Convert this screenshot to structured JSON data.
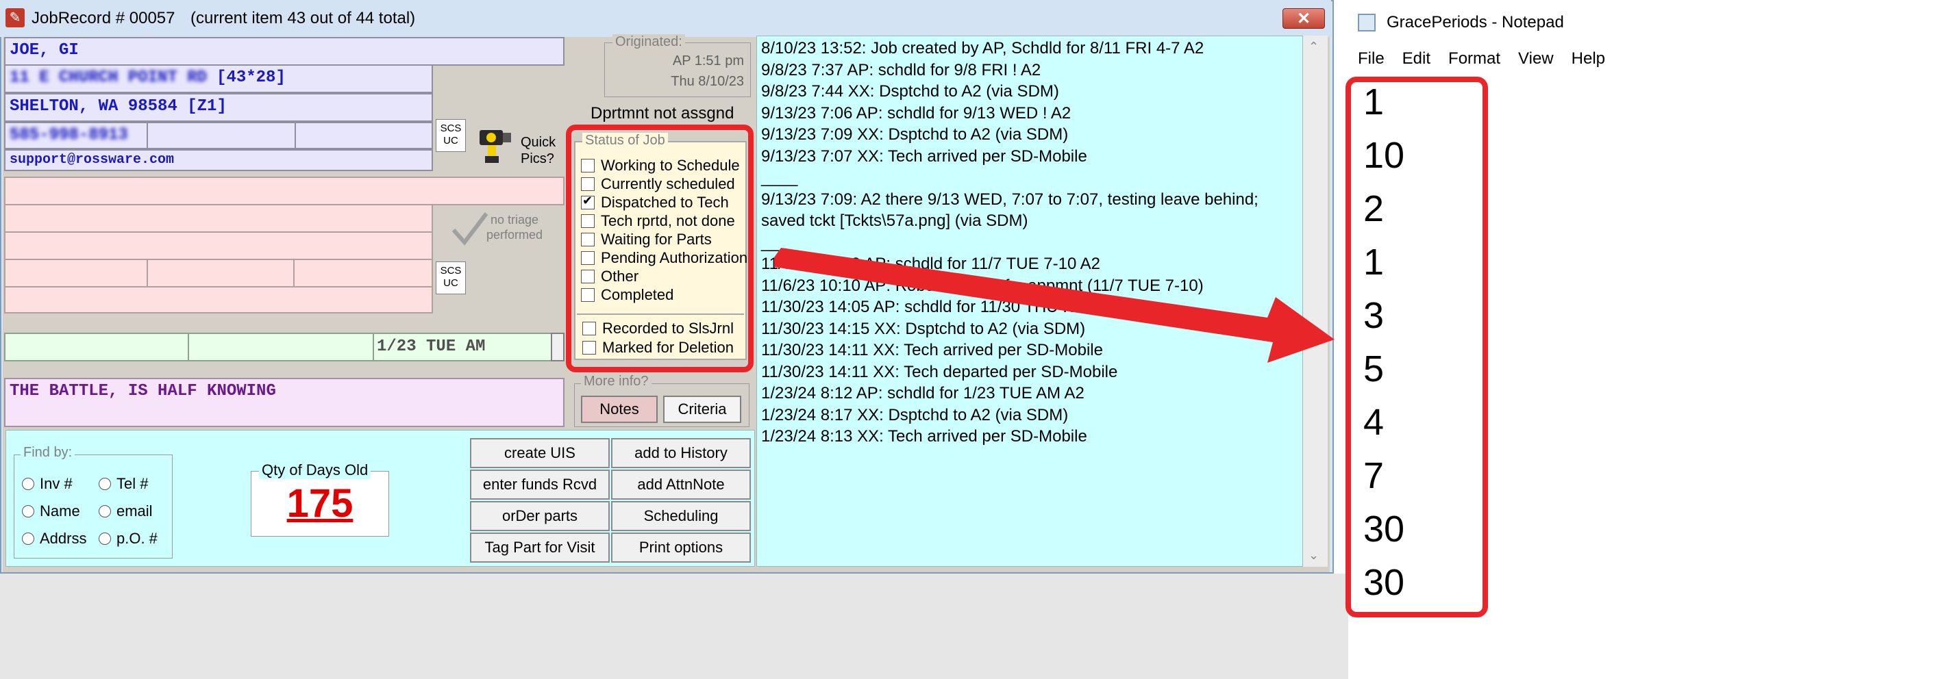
{
  "jobrecord": {
    "title": "JobRecord # 00057",
    "subtitle": "(current item 43 out of 44 total)",
    "close_glyph": "✕",
    "customer": {
      "name": "JOE, GI",
      "address1": "11 E CHURCH POINT RD",
      "address1_suffix": "[43*28]",
      "city": "SHELTON, WA 98584 [Z1]",
      "phone": "585-998-8913",
      "email": "support@rossware.com"
    },
    "scs_uc_label_1": "SCS",
    "scs_uc_label_2": "UC",
    "quick_pics_line1": "Quick",
    "quick_pics_line2": "Pics?",
    "no_triage_line1": "no triage",
    "no_triage_line2": "performed",
    "schedule_field": "1/23 TUE AM",
    "notes_line": "THE BATTLE, IS HALF KNOWING",
    "originated": {
      "legend": "Originated:",
      "line1": "AP 1:51 pm",
      "line2": "Thu 8/10/23"
    },
    "department": "Dprtmnt not assgnd",
    "status": {
      "legend": "Status of Job",
      "items": [
        {
          "label": "Working to Schedule",
          "checked": false
        },
        {
          "label": "Currently scheduled",
          "checked": false
        },
        {
          "label": "Dispatched to Tech",
          "checked": true
        },
        {
          "label": "Tech rprtd, not done",
          "checked": false
        },
        {
          "label": "Waiting for Parts",
          "checked": false
        },
        {
          "label": "Pending Authorization",
          "checked": false
        },
        {
          "label": "Other",
          "checked": false
        },
        {
          "label": "Completed",
          "checked": false
        }
      ],
      "recorded": "Recorded to SlsJrnl",
      "marked": "Marked for Deletion"
    },
    "more_info": {
      "legend": "More info?",
      "notes": "Notes",
      "criteria": "Criteria"
    },
    "history": [
      "8/10/23 13:52: Job created by AP, Schdld for 8/11 FRI 4-7 A2",
      "9/8/23 7:37 AP: schdld for 9/8 FRI ! A2",
      "9/8/23 7:44 XX:  Dsptchd to A2 (via SDM)",
      "9/13/23 7:06 AP: schdld for 9/13 WED ! A2",
      "9/13/23 7:09 XX:  Dsptchd to A2 (via SDM)",
      "9/13/23 7:07 XX: Tech arrived per SD-Mobile",
      "____",
      "9/13/23 7:09: A2 there 9/13 WED, 7:07 to 7:07, testing leave behind;",
      "saved tckt [Tckts\\57a.png] (via SDM)",
      "____",
      "11/6/23 10:09 AP: schdld for 11/7 TUE 7-10 A2",
      "11/6/23 10:10 AP: Robo-call to cnfm appmnt (11/7 TUE 7-10)",
      "11/30/23 14:05 AP: schdld for 11/30 THU ! A2",
      "11/30/23 14:15 XX:  Dsptchd to A2 (via SDM)",
      "11/30/23 14:11 XX: Tech arrived per SD-Mobile",
      "11/30/23 14:11 XX: Tech departed per SD-Mobile",
      "1/23/24 8:12 AP: schdld for 1/23 TUE AM A2",
      "1/23/24 8:17 XX:  Dsptchd to A2 (via SDM)",
      "1/23/24 8:13 XX: Tech arrived per SD-Mobile"
    ],
    "find_by": {
      "legend": "Find by:",
      "inv": "Inv #",
      "tel": "Tel #",
      "name": "Name",
      "email": "email",
      "addrss": "Addrss",
      "po": "p.O. #"
    },
    "qty_days": {
      "legend": "Qty of Days Old",
      "value": "175"
    },
    "buttons": {
      "create_uis": "create UIS",
      "add_history": "add to History",
      "enter_funds": "enter funds Rcvd",
      "add_attnnote": "add AttnNote",
      "order_parts": "orDer parts",
      "scheduling": "Scheduling",
      "tag_part": "Tag Part for Visit",
      "print_options": "Print options"
    }
  },
  "notepad": {
    "title": "GracePeriods - Notepad",
    "menu": [
      "File",
      "Edit",
      "Format",
      "View",
      "Help"
    ],
    "lines": [
      "1",
      "10",
      "2",
      "1",
      "3",
      "5",
      "4",
      "7",
      "30",
      "30"
    ]
  },
  "colors": {
    "highlight": "#e8262a",
    "history_bg": "#ccffff",
    "qty_value": "#e00000"
  }
}
